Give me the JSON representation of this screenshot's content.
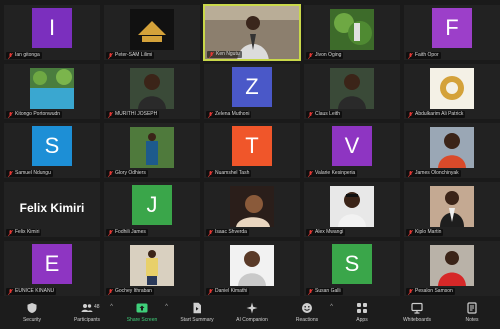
{
  "colors": {
    "tile_bg": "#222222",
    "active_border": "#c9d84a",
    "mic_muted": "#e53935",
    "share_green": "#3fd07a"
  },
  "participants": [
    {
      "name": "Ian gitonga",
      "initial": "I",
      "color": "#7b2fbe"
    },
    {
      "name": "Peter-SAM Lilimi",
      "initial": "",
      "color": "",
      "photo": "logo"
    },
    {
      "name": "Ken Ngutu",
      "initial": "",
      "color": "",
      "photo": "video",
      "active": true
    },
    {
      "name": "Jivon Oging",
      "initial": "",
      "color": "",
      "photo": "plants"
    },
    {
      "name": "Faith Opor",
      "initial": "F",
      "color": "#9c3fc9"
    },
    {
      "name": "Kitongo Portonwudn",
      "initial": "",
      "color": "",
      "photo": "pool"
    },
    {
      "name": "MURITHI JOSEPH",
      "initial": "",
      "color": "",
      "photo": "man"
    },
    {
      "name": "Zelena Muthoni",
      "initial": "Z",
      "color": "#4a58c8"
    },
    {
      "name": "Claus Leith",
      "initial": "",
      "color": "",
      "photo": "man"
    },
    {
      "name": "Abdulkarim Ali Patrick",
      "initial": "",
      "color": "",
      "photo": "emblem"
    },
    {
      "name": "Samuel Ndungu",
      "initial": "S",
      "color": "#1d8fd6"
    },
    {
      "name": "Glory Odhiers",
      "initial": "",
      "color": "",
      "photo": "standing"
    },
    {
      "name": "Nuamshel Tash",
      "initial": "T",
      "color": "#f0562a"
    },
    {
      "name": "Valarie Kesinperia",
      "initial": "V",
      "color": "#8e35c2"
    },
    {
      "name": "James Olonchinyak",
      "initial": "",
      "color": "",
      "photo": "man2"
    },
    {
      "name": "Felix Kimiri",
      "initial": "",
      "color": "",
      "bigname": "Felix Kimiri"
    },
    {
      "name": "Fodhili James",
      "initial": "J",
      "color": "#3aa64a"
    },
    {
      "name": "Isaac Shverda",
      "initial": "",
      "color": "",
      "photo": "dark"
    },
    {
      "name": "Alex Mwangi",
      "initial": "",
      "color": "",
      "photo": "man3"
    },
    {
      "name": "Kiplo Martin",
      "initial": "",
      "color": "",
      "photo": "suit"
    },
    {
      "name": "EUNICE KINANU",
      "initial": "E",
      "color": "#8e35c2"
    },
    {
      "name": "Gochey Ithraban",
      "initial": "",
      "color": "",
      "photo": "standing2"
    },
    {
      "name": "Daniel Kimathi",
      "initial": "",
      "color": "",
      "photo": "bright"
    },
    {
      "name": "Susan Galli",
      "initial": "S",
      "color": "#3aa64a"
    },
    {
      "name": "Pesalon Samson",
      "initial": "",
      "color": "",
      "photo": "red"
    }
  ],
  "toolbar": {
    "security": "Security",
    "participants": "Participants",
    "participants_count": "48",
    "share": "Share Screen",
    "summary": "Start Summary",
    "companion": "AI Companion",
    "reactions": "Reactions",
    "apps": "Apps",
    "whiteboards": "Whiteboards",
    "notes": "Notes"
  }
}
